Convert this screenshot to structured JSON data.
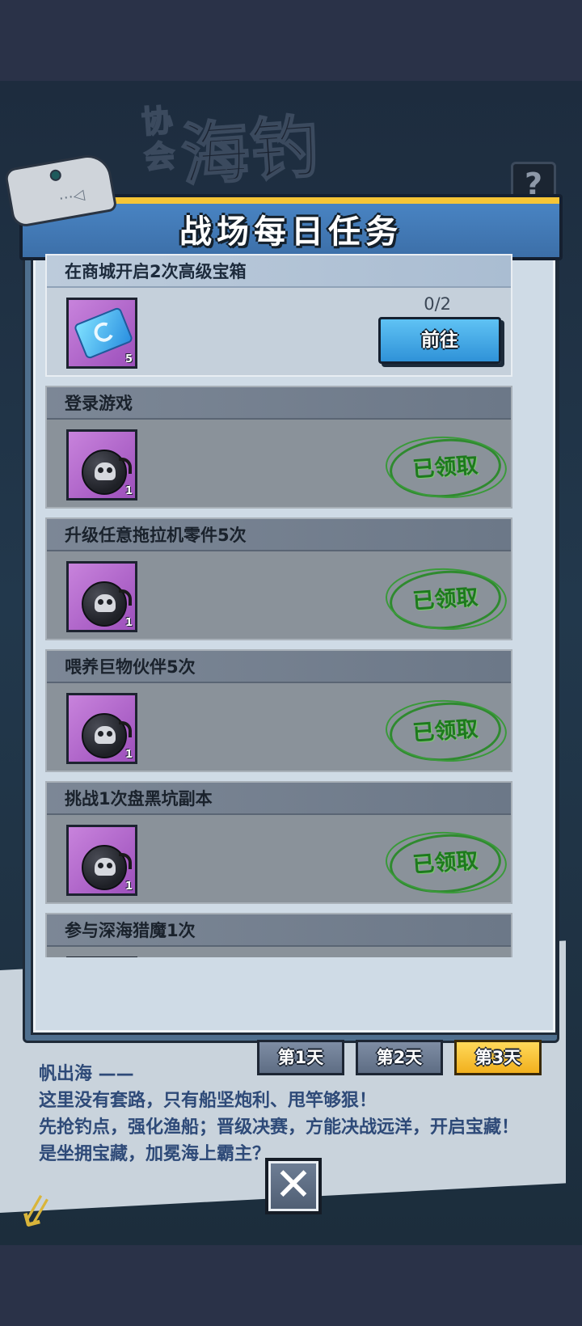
{
  "background": {
    "banner_small": "协会",
    "banner_big": "海钓",
    "question_mark": "?",
    "story_lines": [
      "帆出海 ——",
      "这里没有套路，只有船坚炮利、甩竿够狠！",
      "先抢钓点，强化渔船；晋级决赛，方能决战远洋，开启宝藏！",
      "是坐拥宝藏，加冕海上霸主？"
    ]
  },
  "dialog": {
    "title": "战场每日任务",
    "tasks": [
      {
        "name": "在商城开启2次高级宝箱",
        "reward_icon": "ticket-icon",
        "reward_count": "5",
        "progress": "0/2",
        "action": "前往",
        "claimed": false
      },
      {
        "name": "登录游戏",
        "reward_icon": "skull-bomb-icon",
        "reward_count": "1",
        "status": "已领取",
        "claimed": true
      },
      {
        "name": "升级任意拖拉机零件5次",
        "reward_icon": "skull-bomb-icon",
        "reward_count": "1",
        "status": "已领取",
        "claimed": true
      },
      {
        "name": "喂养巨物伙伴5次",
        "reward_icon": "skull-bomb-icon",
        "reward_count": "1",
        "status": "已领取",
        "claimed": true
      },
      {
        "name": "挑战1次盘黑坑副本",
        "reward_icon": "skull-bomb-icon",
        "reward_count": "1",
        "status": "已领取",
        "claimed": true
      },
      {
        "name": "参与深海猎魔1次",
        "reward_icon": "skull-bomb-icon",
        "claimed": true
      }
    ],
    "day_tabs": [
      {
        "label": "第1天",
        "active": false
      },
      {
        "label": "第2天",
        "active": false
      },
      {
        "label": "第3天",
        "active": true
      }
    ],
    "close_symbol": "✕"
  },
  "colors": {
    "header_blue": "#3c6fa8",
    "header_stripe": "#f6c536",
    "go_button": "#2f92d8",
    "claimed_green": "#1d7a1d",
    "active_tab": "#f1b01e"
  }
}
